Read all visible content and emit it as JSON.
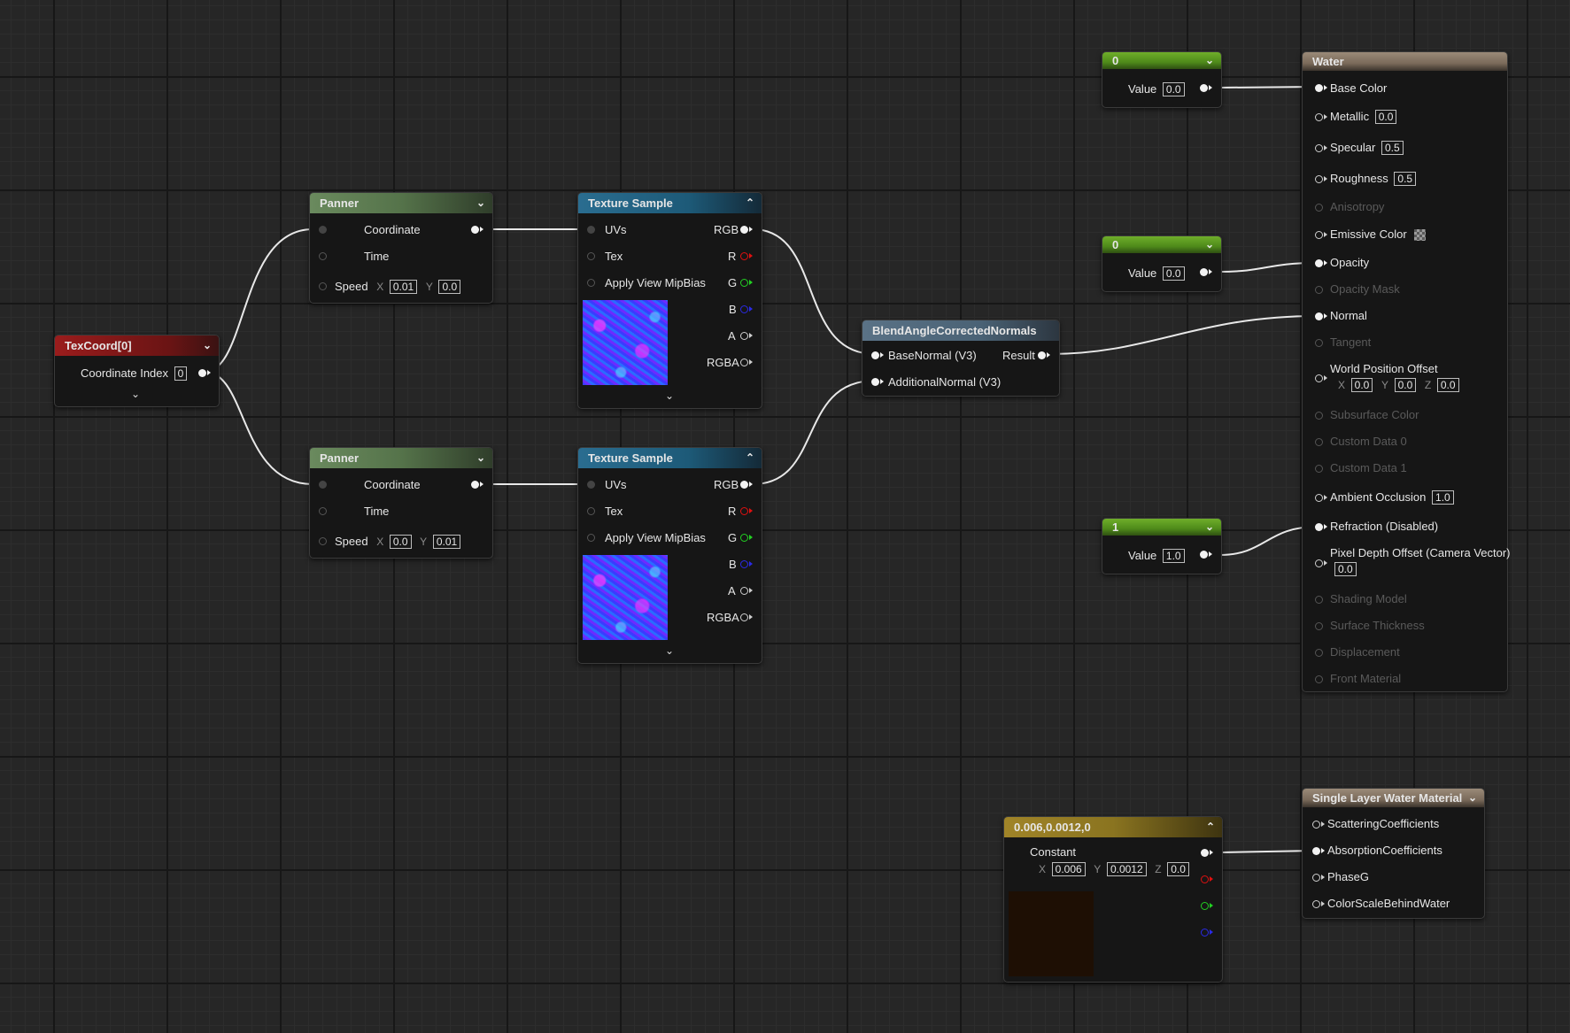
{
  "texcoord": {
    "title": "TexCoord[0]",
    "coord_index_label": "Coordinate Index",
    "coord_index_value": "0"
  },
  "panner1": {
    "title": "Panner",
    "coordinate": "Coordinate",
    "time": "Time",
    "speed": "Speed",
    "x_label": "X",
    "x": "0.01",
    "y_label": "Y",
    "y": "0.0"
  },
  "panner2": {
    "title": "Panner",
    "coordinate": "Coordinate",
    "time": "Time",
    "speed": "Speed",
    "x_label": "X",
    "x": "0.0",
    "y_label": "Y",
    "y": "0.01"
  },
  "tex1": {
    "title": "Texture Sample",
    "uvs": "UVs",
    "tex": "Tex",
    "mip": "Apply View MipBias",
    "rgb": "RGB",
    "r": "R",
    "g": "G",
    "b": "B",
    "a": "A",
    "rgba": "RGBA"
  },
  "tex2": {
    "title": "Texture Sample",
    "uvs": "UVs",
    "tex": "Tex",
    "mip": "Apply View MipBias",
    "rgb": "RGB",
    "r": "R",
    "g": "G",
    "b": "B",
    "a": "A",
    "rgba": "RGBA"
  },
  "blend": {
    "title": "BlendAngleCorrectedNormals",
    "base": "BaseNormal (V3)",
    "additional": "AdditionalNormal (V3)",
    "result": "Result"
  },
  "const_top": {
    "title": "0",
    "label": "Value",
    "value": "0.0"
  },
  "const_mid": {
    "title": "0",
    "label": "Value",
    "value": "0.0"
  },
  "const_low": {
    "title": "1",
    "label": "Value",
    "value": "1.0"
  },
  "vector": {
    "title": "0.006,0.0012,0",
    "label": "Constant",
    "x_label": "X",
    "x": "0.006",
    "y_label": "Y",
    "y": "0.0012",
    "z_label": "Z",
    "z": "0.0"
  },
  "water": {
    "title": "Water",
    "base_color": "Base Color",
    "metallic": "Metallic",
    "metallic_v": "0.0",
    "specular": "Specular",
    "specular_v": "0.5",
    "roughness": "Roughness",
    "roughness_v": "0.5",
    "anisotropy": "Anisotropy",
    "emissive": "Emissive Color",
    "opacity": "Opacity",
    "opacity_mask": "Opacity Mask",
    "normal": "Normal",
    "tangent": "Tangent",
    "wpo": "World Position Offset",
    "wpo_x_label": "X",
    "wpo_x": "0.0",
    "wpo_y_label": "Y",
    "wpo_y": "0.0",
    "wpo_z_label": "Z",
    "wpo_z": "0.0",
    "subsurface": "Subsurface Color",
    "custom0": "Custom Data 0",
    "custom1": "Custom Data 1",
    "ao": "Ambient Occlusion",
    "ao_v": "1.0",
    "refraction": "Refraction (Disabled)",
    "pdo": "Pixel Depth Offset (Camera Vector)",
    "pdo_v": "0.0",
    "shading": "Shading Model",
    "thickness": "Surface Thickness",
    "displacement": "Displacement",
    "front": "Front Material"
  },
  "slw": {
    "title": "Single Layer Water Material",
    "scattering": "ScatteringCoefficients",
    "absorption": "AbsorptionCoefficients",
    "phaseg": "PhaseG",
    "colorscale": "ColorScaleBehindWater"
  },
  "colors": {
    "texcoord_header": "#8c1a1a",
    "panner_header": "#55734a",
    "texture_header": "#1d5a78",
    "function_header": "#4a6275",
    "scalar_header": "#4e8a1a",
    "vector_header": "#8a7420",
    "output_header": "#8a7a6a"
  }
}
